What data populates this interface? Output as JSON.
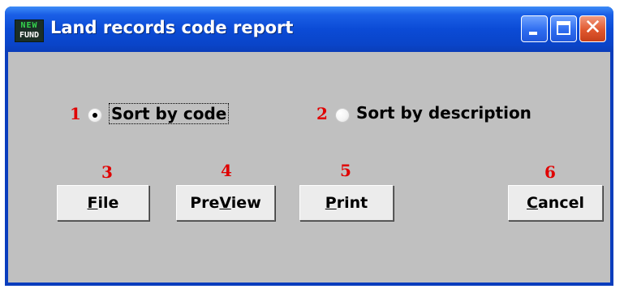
{
  "window": {
    "title": "Land records code report",
    "icon": {
      "line1": "NEW",
      "line2": "FUND"
    }
  },
  "controls": {
    "minimize": "minimize-icon",
    "maximize": "maximize-icon",
    "close": "close-icon",
    "close_glyph": "✕"
  },
  "options": [
    {
      "number": "1",
      "label": "Sort by code",
      "selected": true
    },
    {
      "number": "2",
      "label": "Sort by description",
      "selected": false
    }
  ],
  "buttons": [
    {
      "number": "3",
      "pre": "",
      "underline": "F",
      "post": "ile"
    },
    {
      "number": "4",
      "pre": "Pre",
      "underline": "V",
      "post": "iew"
    },
    {
      "number": "5",
      "pre": "",
      "underline": "P",
      "post": "rint"
    },
    {
      "number": "6",
      "pre": "",
      "underline": "C",
      "post": "ancel"
    }
  ]
}
